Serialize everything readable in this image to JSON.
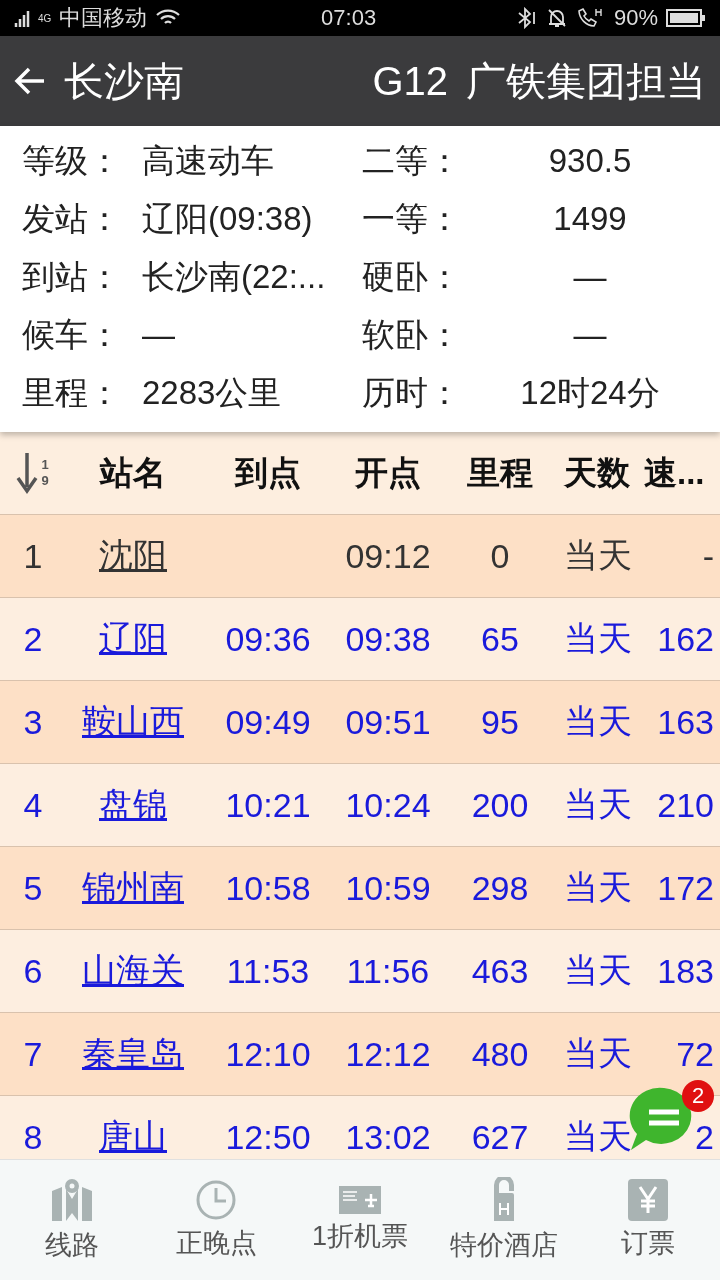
{
  "status_bar": {
    "carrier": "中国移动",
    "network": "4G",
    "time": "07:03",
    "battery": "90%"
  },
  "title_bar": {
    "station": "长沙南",
    "train": "G12",
    "operator": "广铁集团担当"
  },
  "info": [
    {
      "label": "等级：",
      "value": "高速动车",
      "label2": "二等：",
      "value2": "930.5"
    },
    {
      "label": "发站：",
      "value": "辽阳(09:38)",
      "label2": "一等：",
      "value2": "1499"
    },
    {
      "label": "到站：",
      "value": "长沙南(22:...",
      "label2": "硬卧：",
      "value2": "—"
    },
    {
      "label": "候车：",
      "value": "—",
      "label2": "软卧：",
      "value2": "—"
    },
    {
      "label": "里程：",
      "value": "2283公里",
      "label2": "历时：",
      "value2": "12时24分"
    }
  ],
  "table": {
    "sort_digits": [
      "1",
      "9"
    ],
    "columns": [
      "站名",
      "到点",
      "开点",
      "里程",
      "天数",
      "速..."
    ],
    "rows": [
      {
        "no": "1",
        "station": "沈阳",
        "arrive": "",
        "depart": "09:12",
        "distance": "0",
        "day": "当天",
        "speed": "-",
        "kind": "origin"
      },
      {
        "no": "2",
        "station": "辽阳",
        "arrive": "09:36",
        "depart": "09:38",
        "distance": "65",
        "day": "当天",
        "speed": "162",
        "kind": "stop"
      },
      {
        "no": "3",
        "station": "鞍山西",
        "arrive": "09:49",
        "depart": "09:51",
        "distance": "95",
        "day": "当天",
        "speed": "163",
        "kind": "stop"
      },
      {
        "no": "4",
        "station": "盘锦",
        "arrive": "10:21",
        "depart": "10:24",
        "distance": "200",
        "day": "当天",
        "speed": "210",
        "kind": "stop"
      },
      {
        "no": "5",
        "station": "锦州南",
        "arrive": "10:58",
        "depart": "10:59",
        "distance": "298",
        "day": "当天",
        "speed": "172",
        "kind": "stop"
      },
      {
        "no": "6",
        "station": "山海关",
        "arrive": "11:53",
        "depart": "11:56",
        "distance": "463",
        "day": "当天",
        "speed": "183",
        "kind": "stop"
      },
      {
        "no": "7",
        "station": "秦皇岛",
        "arrive": "12:10",
        "depart": "12:12",
        "distance": "480",
        "day": "当天",
        "speed": "72",
        "kind": "stop"
      },
      {
        "no": "8",
        "station": "唐山",
        "arrive": "12:50",
        "depart": "13:02",
        "distance": "627",
        "day": "当天",
        "speed": "2",
        "kind": "stop"
      }
    ]
  },
  "chat_badge": "2",
  "nav": [
    {
      "label": "线路",
      "kind": "map"
    },
    {
      "label": "正晚点",
      "kind": "clock"
    },
    {
      "label": "1折机票",
      "kind": "ticket"
    },
    {
      "label": "特价酒店",
      "kind": "hotel"
    },
    {
      "label": "订票",
      "kind": "yen"
    }
  ]
}
